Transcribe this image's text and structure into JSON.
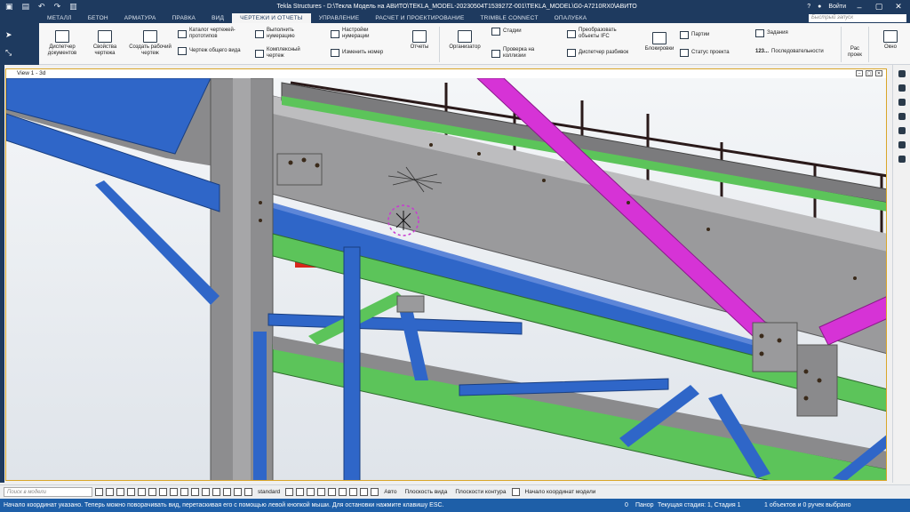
{
  "titlebar": {
    "title": "Tekla Structures - D:\\Текла Модель на АВИТО\\TEKLA_MODEL-20230504T153927Z-001\\TEKLA_MODEL\\G0-A7210RX0\\АВИТО",
    "user": "Войти",
    "help": "?"
  },
  "menu": {
    "tabs": [
      "МЕТАЛЛ",
      "БЕТОН",
      "АРМАТУРА",
      "ПРАВКА",
      "ВИД",
      "ЧЕРТЕЖИ И ОТЧЕТЫ",
      "УПРАВЛЕНИЕ",
      "РАСЧЕТ И ПРОЕКТИРОВАНИЕ",
      "TRIMBLE CONNECT",
      "ОПАЛУБКА"
    ],
    "active_tab": "ЧЕРТЕЖИ И ОТЧЕТЫ",
    "search_placeholder": "Быстрый запуск"
  },
  "ribbon": {
    "doc_manager": "Диспетчер документов",
    "drawing_props": "Свойства чертежа",
    "create_working": "Создать рабочий чертеж",
    "catalog": "Каталог чертежей-прототипов",
    "general_view": "Чертеж общего вида",
    "do_numbering": "Выполнить нумерацию",
    "complex_drawing": "Комплексный чертеж",
    "numbering_settings": "Настройки нумерации",
    "change_number": "Изменить номер",
    "reports": "Отчеты",
    "organizer": "Организатор",
    "stages": "Стадии",
    "clash_check": "Проверка на коллизии",
    "convert_ifc": "Преобразовать объекты IFC",
    "layout_manager": "Диспетчер разбивок",
    "locks": "Блокировки",
    "lots": "Партии",
    "project_status": "Статус проекта",
    "tasks": "Задания",
    "sequences": "Последовательности",
    "sequences_prefix": "123...",
    "ras": "Рас проек",
    "window": "Окно"
  },
  "view": {
    "title": "View 1 - 3d"
  },
  "bottombar": {
    "search_placeholder": "Поиск в модели",
    "standard": "standard",
    "auto": "Авто",
    "view_plane": "Плоскость вида",
    "contour_plane": "Плоскости контура",
    "origin": "Начало координат модели"
  },
  "status": {
    "message": "Начало координат указано. Теперь можно поворачивать вид, перетаскивая его с помощью левой кнопкой мыши. Для остановки нажмите клавишу ESC.",
    "zero": "0",
    "panel": "Панор",
    "stage": "Текущая стадия: 1, Стадия 1",
    "selection": "1 объектов и 0 ручек выбрано"
  },
  "colors": {
    "blue_member": "#2f66c8",
    "green_member": "#5cc45a",
    "magenta_member": "#d633d6",
    "gray_member": "#9a9a9c",
    "status_blue": "#1e5fa8",
    "title_navy": "#1e3a5f"
  }
}
